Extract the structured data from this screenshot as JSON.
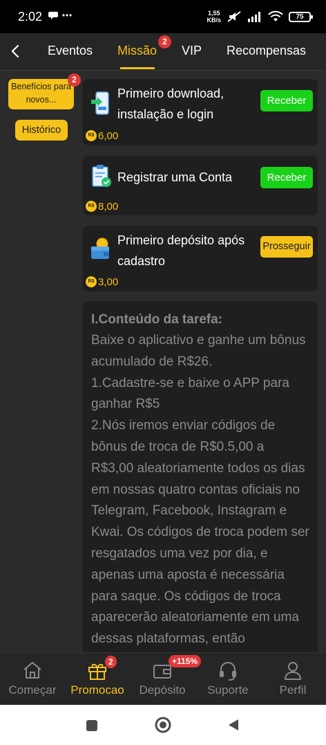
{
  "status_bar": {
    "time": "2:02",
    "speed_top": "1,55",
    "speed_bottom": "KB/s",
    "battery": "75"
  },
  "tabs": [
    {
      "label": "Eventos",
      "active": false
    },
    {
      "label": "Missão",
      "active": true,
      "badge": "2"
    },
    {
      "label": "VIP",
      "active": false
    },
    {
      "label": "Recompensas",
      "active": false
    }
  ],
  "sidebar": {
    "category_label": "Benefícios para novos...",
    "category_badge": "2",
    "history_label": "Histórico"
  },
  "tasks": [
    {
      "title": "Primeiro download, instalação e login",
      "reward": "6,00",
      "button": "Receber",
      "icon": "phone-download-icon"
    },
    {
      "title": "Registrar uma Conta",
      "reward": "8,00",
      "button": "Receber",
      "icon": "clipboard-check-icon"
    },
    {
      "title": "Primeiro depósito após cadastro",
      "reward": "3,00",
      "button": "Prosseguir",
      "icon": "wallet-coin-icon"
    }
  ],
  "currency_symbol": "R$",
  "description": {
    "title": "I.Conteúdo da tarefa:",
    "body": "Baixe o aplicativo e ganhe um bônus acumulado de R$26.\n1.Cadastre-se e baixe o APP para ganhar R$5\n2.Nós iremos enviar códigos de bônus de troca de R$0.5,00 a R$3,00 aleatoriamente todos os dias em nossas quatro contas oficiais no Telegram, Facebook, Instagram e Kwai. Os códigos de troca podem ser resgatados uma vez por dia, e apenas uma aposta é necessária para saque. Os códigos de troca aparecerão aleatoriamente em uma dessas plataformas, então"
  },
  "bottom_nav": [
    {
      "label": "Começar",
      "icon": "home-icon"
    },
    {
      "label": "Promocao",
      "icon": "gift-icon",
      "active": true,
      "badge": "2"
    },
    {
      "label": "Depósito",
      "icon": "wallet-icon",
      "badge": "+115%"
    },
    {
      "label": "Suporte",
      "icon": "headset-icon"
    },
    {
      "label": "Perfil",
      "icon": "user-icon"
    }
  ],
  "colors": {
    "accent": "#f5c21a",
    "green": "#1ad11a",
    "badge": "#e03838",
    "background": "#2b2b2b",
    "card": "#1f1f1f"
  }
}
